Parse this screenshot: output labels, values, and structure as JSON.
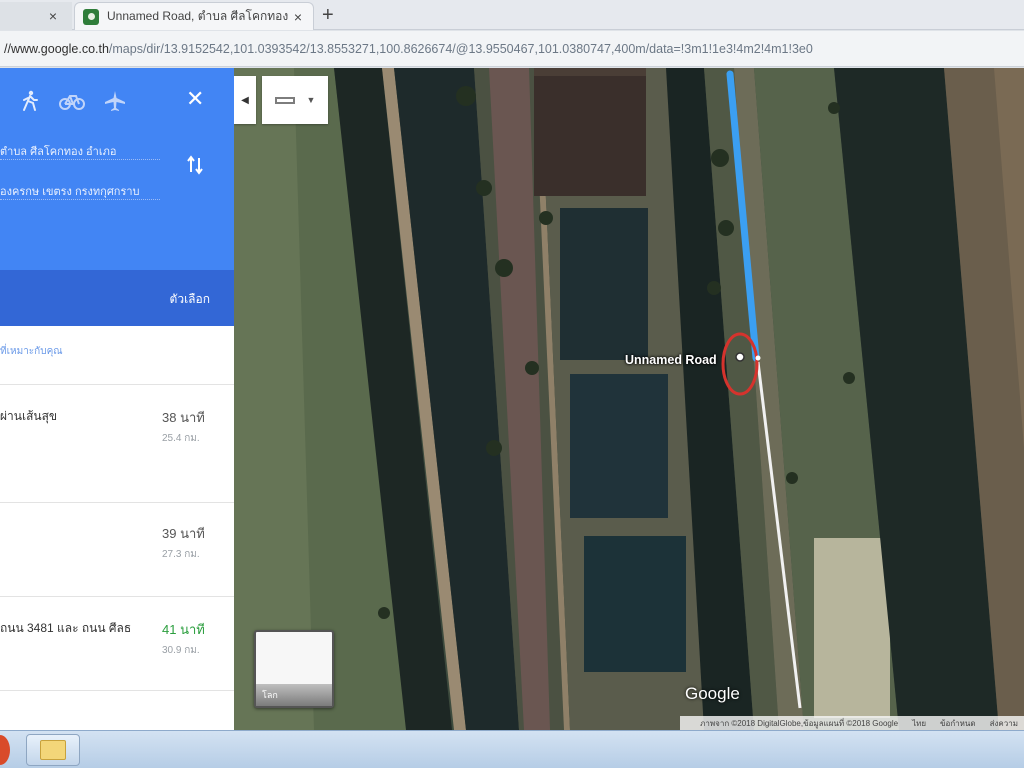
{
  "browser": {
    "tabs": [
      {
        "label": "",
        "close": "×"
      },
      {
        "label": "Unnamed Road, ตำบล ศีลโคกทอง ป",
        "close": "×"
      }
    ],
    "new_tab": "+",
    "url_domain": "//www.google.co.th",
    "url_path": "/maps/dir/13.9152542,101.0393542/13.8553271,100.8626674/@13.9550467,101.0380747,400m/data=!3m1!1e3!4m2!4m1!3e0"
  },
  "panel": {
    "mode_icons": [
      "walk-icon",
      "bicycle-icon",
      "flight-icon"
    ],
    "close": "✕",
    "origin": "ตำบล ศีลโคกทอง อำเภอ",
    "destination": "องครกษ เขตรง กรงทกุศกราบ",
    "options": "ตัวเลือก",
    "hint": "ที่เหมาะกับคุณ",
    "routes": [
      {
        "name": "ผ่านเส้นสุข",
        "time": "38 นาที",
        "distance": "25.4 กม.",
        "time_color": "gray"
      },
      {
        "name": "",
        "time": "39 นาที",
        "distance": "27.3 กม.",
        "time_color": "gray"
      },
      {
        "name": "ถนน 3481 และ ถนน ศีลธ",
        "time": "41 นาที",
        "distance": "30.9 กม.",
        "time_color": "green"
      }
    ]
  },
  "map": {
    "collapse": "◀",
    "layer_caret": "▼",
    "road_label": "Unnamed Road",
    "minimap_label": "โลก",
    "logo": "Google",
    "attribution": [
      "ภาพจาก ©2018 DigitalGlobe,ข้อมูลแผนที่ ©2018 Google",
      "ไทย",
      "ข้อกำหนด",
      "ส่งความ"
    ],
    "route_line_color": "#3b9ff2"
  }
}
